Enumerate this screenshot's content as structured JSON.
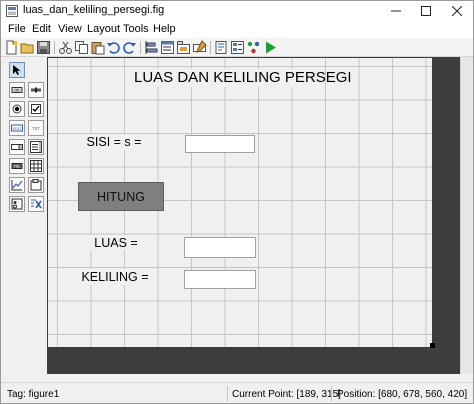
{
  "window": {
    "title": "luas_dan_keliling_persegi.fig",
    "controls": {
      "minimize": "—",
      "maximize": "☐",
      "close": "✕"
    }
  },
  "menu": [
    "File",
    "Edit",
    "View",
    "Layout",
    "Tools",
    "Help"
  ],
  "toolbar": {
    "buttons": [
      "new-file-icon",
      "open-folder-icon",
      "save-icon",
      "cut-icon",
      "copy-icon",
      "paste-icon",
      "undo-icon",
      "redo-icon",
      "align-objects-icon",
      "menu-editor-icon",
      "tab-order-editor-icon",
      "toolbar-editor-icon",
      "editor-icon",
      "property-inspector-icon",
      "object-browser-icon",
      "run-figure-icon"
    ],
    "run_color": "#1e9e2e"
  },
  "palette": [
    "select-arrow-icon",
    "push-button-icon",
    "slider-icon",
    "radio-button-icon",
    "checkbox-icon",
    "edit-text-icon",
    "static-text-icon",
    "popup-menu-icon",
    "listbox-icon",
    "toggle-button-icon",
    "table-icon",
    "axes-icon",
    "panel-icon",
    "button-group-icon",
    "activex-control-icon"
  ],
  "figure": {
    "title": "LUAS DAN KELILING PERSEGI",
    "sisi_label": "SISI = s =",
    "sisi_value": "",
    "hitung_label": "HITUNG",
    "hitung_color": "#7f7f7f",
    "luas_label": "LUAS =",
    "luas_value": "",
    "keliling_label": "KELILING =",
    "keliling_value": ""
  },
  "status": {
    "tag": "Tag: figure1",
    "current_point": "Current Point:  [189, 315]",
    "position": "Position: [680, 678, 560, 420]"
  }
}
